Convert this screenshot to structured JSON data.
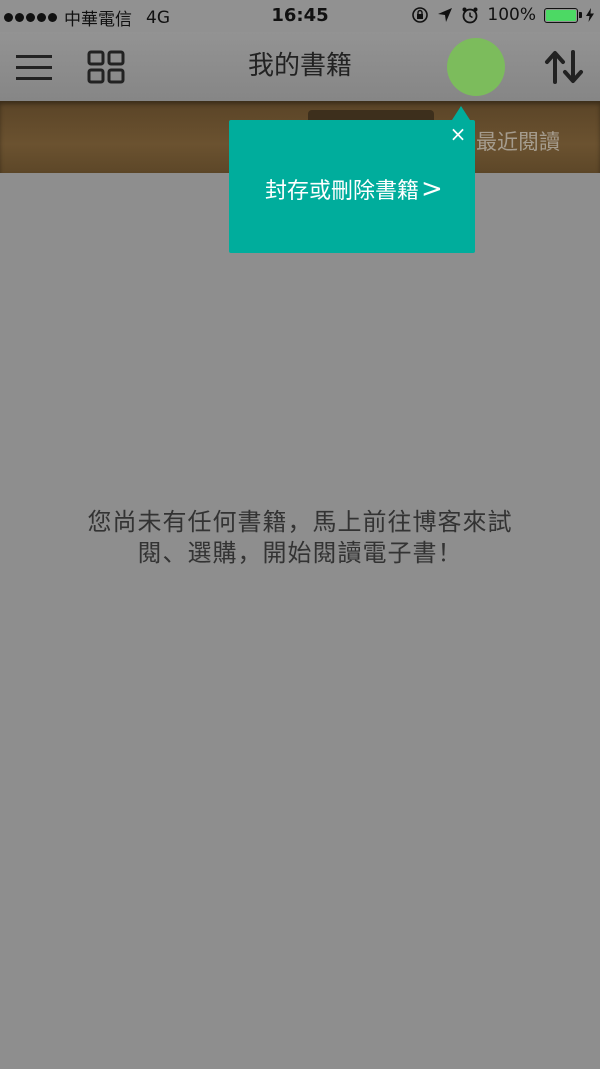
{
  "status_bar": {
    "carrier": "中華電信",
    "network": "4G",
    "time": "16:45",
    "battery": "100%",
    "battery_color": "#4cd964"
  },
  "nav": {
    "title": "我的書籍",
    "menu_icon": "hamburger-icon",
    "grid_icon": "grid-view-icon",
    "sort_icon": "sort-icon",
    "highlight_color": "#7cbc5c"
  },
  "shelf": {
    "recent_label": "最近閱讀"
  },
  "tooltip": {
    "close_label": "×",
    "link_text": "封存或刪除書籍",
    "chevron": ">",
    "background": "#00ad9c"
  },
  "empty_state": {
    "line1": "您尚未有任何書籍，馬上前往博客來試",
    "line2": "閱、選購，開始閱讀電子書！"
  }
}
